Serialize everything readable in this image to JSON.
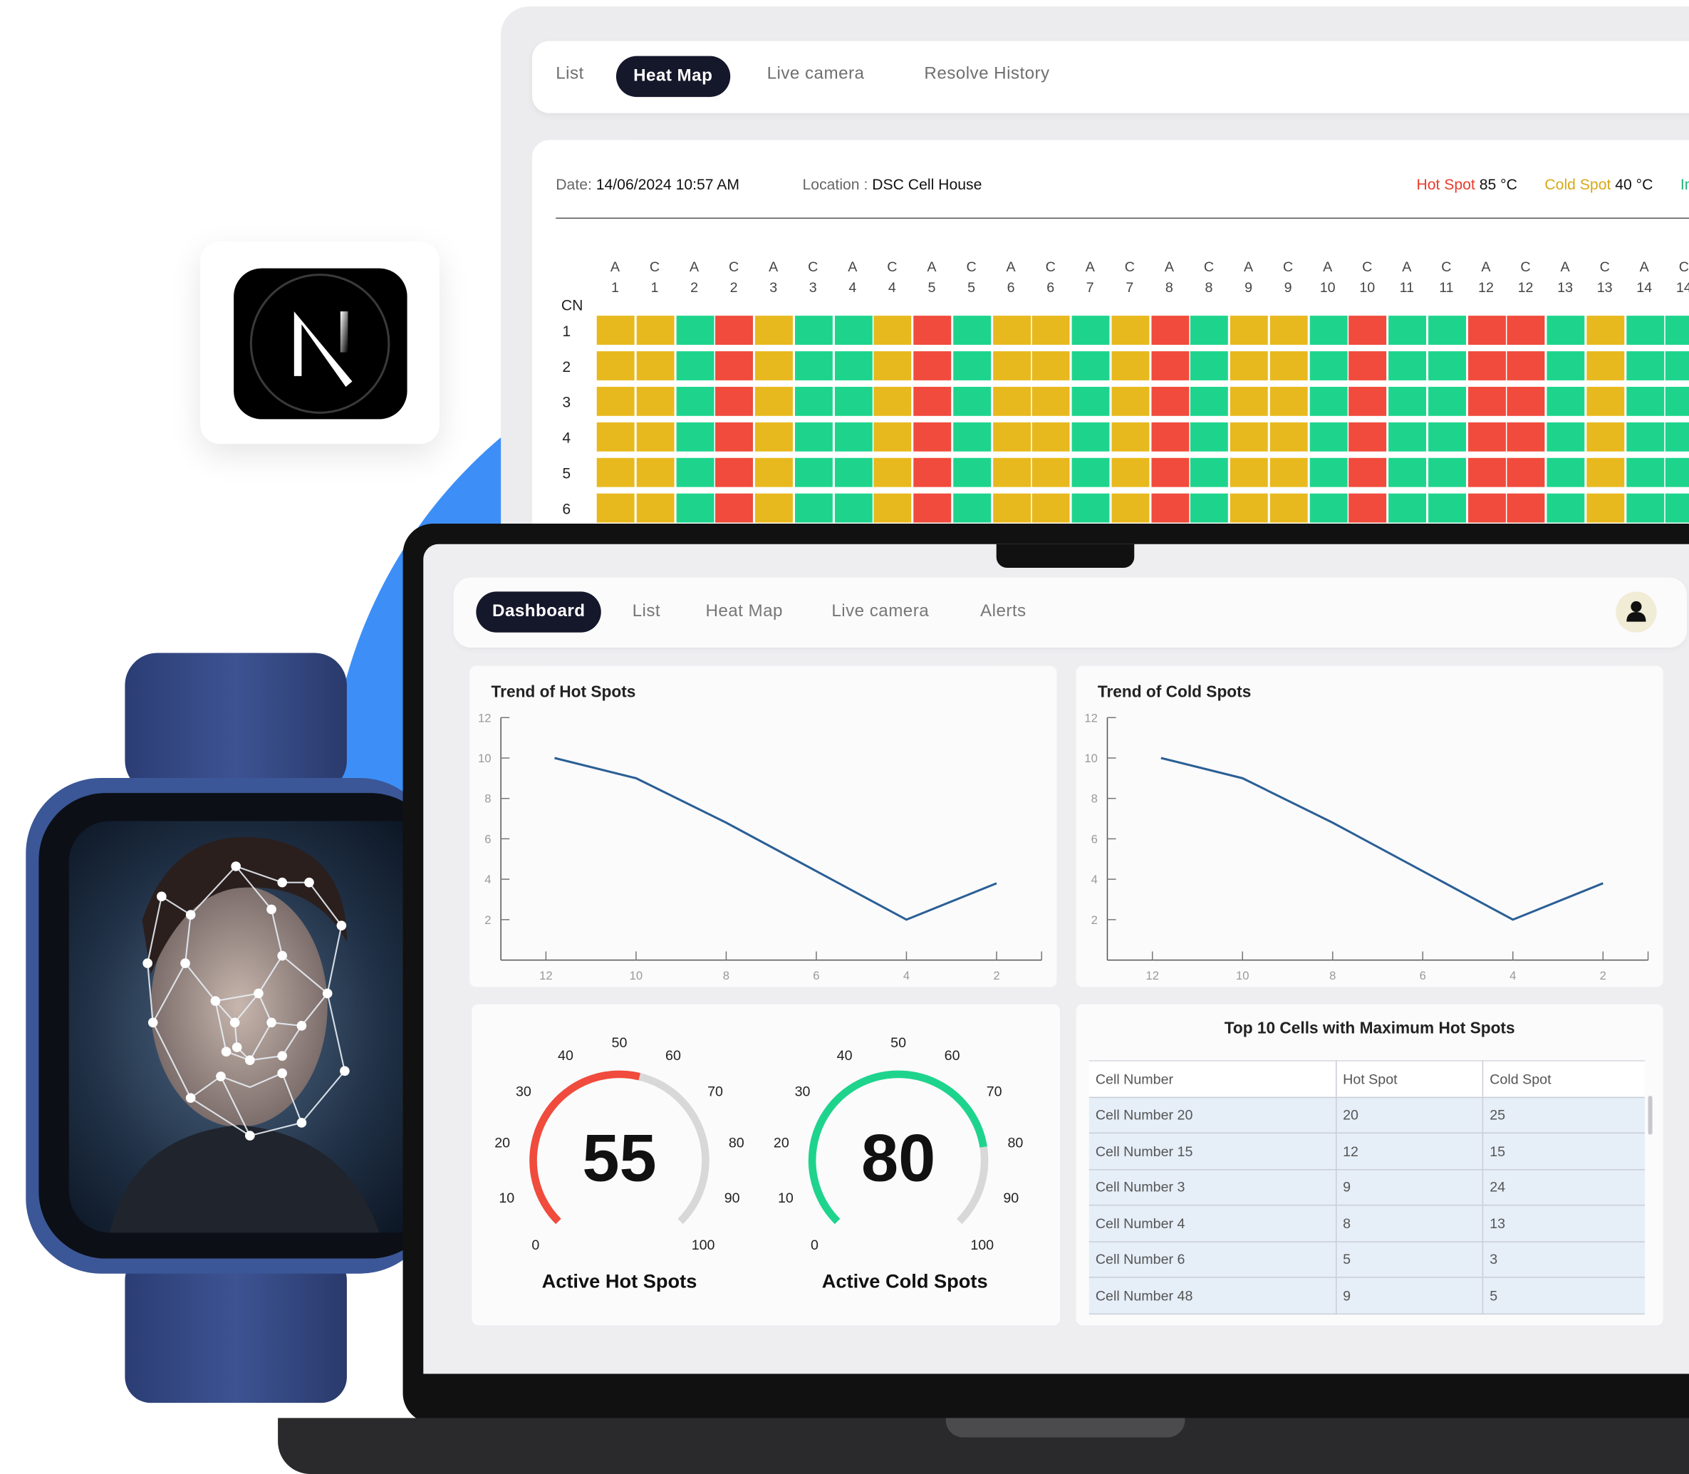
{
  "colors": {
    "hot": "#f04b3c",
    "cold": "#e8b91e",
    "ok": "#1ed48d",
    "dark": "#15172a",
    "blue": "#3d8ff7"
  },
  "back": {
    "tabs": [
      "List",
      "Heat Map",
      "Live camera",
      "Resolve History"
    ],
    "active_tab": "Heat Map",
    "date_label": "Date:",
    "date_value": "14/06/2024 10:57 AM",
    "location_label": "Location :",
    "location_value": "DSC Cell House",
    "hot_label": "Hot Spot",
    "hot_value": "85",
    "hot_unit": "°C",
    "cold_label": "Cold Spot",
    "cold_value": "40",
    "cold_unit": "°C",
    "third_label": "In",
    "cn_label": "CN",
    "columns": [
      [
        "A",
        "1"
      ],
      [
        "C",
        "1"
      ],
      [
        "A",
        "2"
      ],
      [
        "C",
        "2"
      ],
      [
        "A",
        "3"
      ],
      [
        "C",
        "3"
      ],
      [
        "A",
        "4"
      ],
      [
        "C",
        "4"
      ],
      [
        "A",
        "5"
      ],
      [
        "C",
        "5"
      ],
      [
        "A",
        "6"
      ],
      [
        "C",
        "6"
      ],
      [
        "A",
        "7"
      ],
      [
        "C",
        "7"
      ],
      [
        "A",
        "8"
      ],
      [
        "C",
        "8"
      ],
      [
        "A",
        "9"
      ],
      [
        "C",
        "9"
      ],
      [
        "A",
        "10"
      ],
      [
        "C",
        "10"
      ],
      [
        "A",
        "11"
      ],
      [
        "C",
        "11"
      ],
      [
        "A",
        "12"
      ],
      [
        "C",
        "12"
      ],
      [
        "A",
        "13"
      ],
      [
        "C",
        "13"
      ],
      [
        "A",
        "14"
      ],
      [
        "C",
        "14"
      ]
    ],
    "rows": [
      "1",
      "2",
      "3",
      "4",
      "5",
      "6"
    ],
    "row_pattern": [
      "Y",
      "Y",
      "G",
      "R",
      "Y",
      "G",
      "G",
      "Y",
      "R",
      "G",
      "Y",
      "Y",
      "G",
      "Y",
      "R",
      "G",
      "Y",
      "Y",
      "G",
      "R",
      "G",
      "G",
      "R",
      "R",
      "G",
      "Y",
      "G",
      "G"
    ]
  },
  "dashboard": {
    "tabs": [
      "Dashboard",
      "List",
      "Heat Map",
      "Live camera",
      "Alerts"
    ],
    "active_tab": "Dashboard",
    "avatar_icon": "user-icon"
  },
  "chart_data": [
    {
      "type": "line",
      "title": "Trend of Hot Spots",
      "x": [
        12,
        10,
        8,
        6,
        4,
        2
      ],
      "y": [
        10,
        9,
        6.8,
        4.4,
        2,
        3.8
      ],
      "xticks": [
        "12",
        "10",
        "8",
        "6",
        "4",
        "2"
      ],
      "yticks": [
        "12",
        "10",
        "8",
        "6",
        "4",
        "2"
      ],
      "xlim": [
        13,
        1
      ],
      "ylim": [
        0,
        12
      ],
      "color": "#2b5f95"
    },
    {
      "type": "line",
      "title": "Trend of Cold Spots",
      "x": [
        12,
        10,
        8,
        6,
        4,
        2
      ],
      "y": [
        10,
        9,
        6.8,
        4.4,
        2,
        3.8
      ],
      "xticks": [
        "12",
        "10",
        "8",
        "6",
        "4",
        "2"
      ],
      "yticks": [
        "12",
        "10",
        "8",
        "6",
        "4",
        "2"
      ],
      "xlim": [
        13,
        1
      ],
      "ylim": [
        0,
        12
      ],
      "color": "#2b5f95"
    }
  ],
  "gauges": [
    {
      "label": "Active Hot Spots",
      "value": 55,
      "display": "55",
      "max": 100,
      "color": "#f04b3c",
      "ticks": [
        "0",
        "10",
        "20",
        "30",
        "40",
        "50",
        "60",
        "70",
        "80",
        "90",
        "100"
      ]
    },
    {
      "label": "Active Cold Spots",
      "value": 80,
      "display": "80",
      "max": 100,
      "color": "#1ed48d",
      "ticks": [
        "0",
        "10",
        "20",
        "30",
        "40",
        "50",
        "60",
        "70",
        "80",
        "90",
        "100"
      ]
    }
  ],
  "table": {
    "title": "Top 10 Cells with Maximum Hot Spots",
    "headers": [
      "Cell Number",
      "Hot Spot",
      "Cold Spot"
    ],
    "rows": [
      [
        "Cell Number 20",
        "20",
        "25"
      ],
      [
        "Cell Number 15",
        "12",
        "15"
      ],
      [
        "Cell Number 3",
        "9",
        "24"
      ],
      [
        "Cell Number 4",
        "8",
        "13"
      ],
      [
        "Cell Number 6",
        "5",
        "3"
      ],
      [
        "Cell Number 48",
        "9",
        "5"
      ]
    ]
  }
}
